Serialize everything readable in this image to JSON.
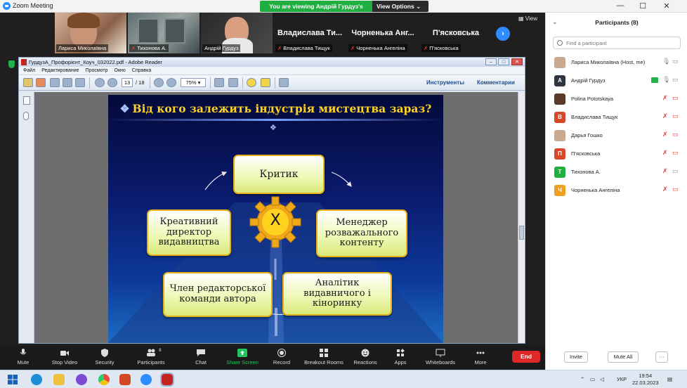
{
  "window": {
    "title": "Zoom Meeting",
    "min": "—",
    "max": "☐",
    "close": "✕"
  },
  "share_banner": {
    "viewing": "You are viewing Андрій Гурдуз's screen",
    "view_options": "View Options",
    "chevron": "⌄"
  },
  "video_strip": {
    "tiles": [
      {
        "name": "Лариса Миколаївна",
        "muted": false
      },
      {
        "name": "Тихонова А.",
        "muted": true
      },
      {
        "name": "Андрій Гурдуз",
        "muted": false
      },
      {
        "name": "Владислава Ти...",
        "sub": "Владислава Тищук",
        "muted": true
      },
      {
        "name": "Чорненька Анг...",
        "sub": "Чорненька Ангеліна",
        "muted": true
      },
      {
        "name": "П'ясковська",
        "sub": "П'ясковська",
        "muted": true
      }
    ],
    "next_symbol": "›",
    "view_label": "View"
  },
  "reader": {
    "title": "ГурдузА_Профорієнт_Коуч_032022.pdf - Adobe Reader",
    "menu": [
      "Файл",
      "Редактирование",
      "Просмотр",
      "Окно",
      "Справка"
    ],
    "page_current": "13",
    "page_total": "/ 18",
    "zoom": "75%",
    "tools_link": "Инструменты",
    "comments_link": "Комментарии",
    "ctl_min": "–",
    "ctl_max": "□",
    "ctl_close": "✕"
  },
  "slide": {
    "title": "Від кого залежить індустрія мистецтва зараз?",
    "bullet": "❖",
    "center_label": "Х",
    "nodes": {
      "critic": "Критик",
      "manager": "Менеджер розважального контенту",
      "analyst": "Аналітик видавничого і кіноринку",
      "editor": "Член редакторської команди автора",
      "creative": "Креативний директор видавництва"
    }
  },
  "bottombar": {
    "items": [
      {
        "key": "mute",
        "label": "Mute"
      },
      {
        "key": "stop_video",
        "label": "Stop Video"
      },
      {
        "key": "security",
        "label": "Security"
      },
      {
        "key": "participants",
        "label": "Participants",
        "count": "8"
      },
      {
        "key": "chat",
        "label": "Chat"
      },
      {
        "key": "share_screen",
        "label": "Share Screen"
      },
      {
        "key": "record",
        "label": "Record"
      },
      {
        "key": "breakout",
        "label": "Breakout Rooms"
      },
      {
        "key": "reactions",
        "label": "Reactions"
      },
      {
        "key": "apps",
        "label": "Apps"
      },
      {
        "key": "whiteboards",
        "label": "Whiteboards"
      },
      {
        "key": "more",
        "label": "More"
      }
    ],
    "end_label": "End"
  },
  "panel": {
    "title": "Participants (8)",
    "search_placeholder": "Find a participant",
    "participants": [
      {
        "name": "Лариса Миколаївна (Host, me)",
        "initial": "",
        "color": "#c9a98f",
        "mic_muted": false,
        "cam_off": false
      },
      {
        "name": "Андрій Гурдуз",
        "initial": "А",
        "color": "#2f3640",
        "mic_muted": false,
        "cam_off": false,
        "sharing": true
      },
      {
        "name": "Polina Pototskaya",
        "initial": "",
        "color": "#5a3a2a",
        "mic_muted": true,
        "cam_off": true
      },
      {
        "name": "Владислава Тищук",
        "initial": "В",
        "color": "#d9472b",
        "mic_muted": true,
        "cam_off": true
      },
      {
        "name": "Дарья Гошко",
        "initial": "",
        "color": "#c9a98f",
        "mic_muted": true,
        "cam_off": true
      },
      {
        "name": "П'ясковська",
        "initial": "П",
        "color": "#d9472b",
        "mic_muted": true,
        "cam_off": true
      },
      {
        "name": "Тихонова А.",
        "initial": "Т",
        "color": "#1fae3f",
        "mic_muted": true,
        "cam_off": false
      },
      {
        "name": "Чорненька Ангеліна",
        "initial": "Ч",
        "color": "#f0a020",
        "mic_muted": true,
        "cam_off": true
      }
    ],
    "invite": "Invite",
    "mute_all": "Mute All",
    "more": "···"
  },
  "taskbar": {
    "lang": "УКР",
    "time": "19:54",
    "date": "22.03.2023"
  },
  "colors": {
    "zoom_blue": "#2d8cff",
    "share_green": "#1fae3f",
    "end_red": "#e02828",
    "slide_title": "#ffd21f"
  }
}
